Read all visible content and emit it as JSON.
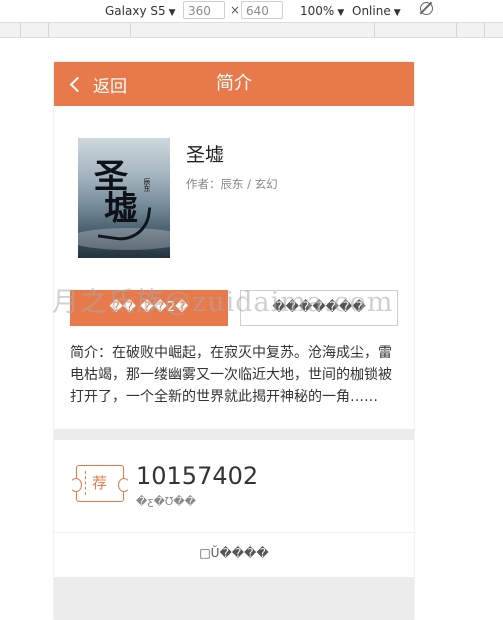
{
  "devtools": {
    "device": "Galaxy S5",
    "width": "360",
    "height": "640",
    "zoom": "100%",
    "network": "Online"
  },
  "header": {
    "back_label": "返回",
    "title": "简介"
  },
  "book": {
    "title": "圣墟",
    "meta": "作者：辰东 / 玄幻",
    "cover_text_1": "圣",
    "cover_text_2": "墟",
    "cover_author": "辰东"
  },
  "actions": {
    "primary_label": "�� ��2�",
    "secondary_label": "�������"
  },
  "summary": "简介：在破败中崛起，在寂灭中复苏。沧海成尘，雷电枯竭，那一缕幽雾又一次临近大地，世间的枷锁被打开了，一个全新的世界就此揭开神秘的一角……",
  "ticket": {
    "icon_char": "荐",
    "count": "10157402",
    "label": "�ƹ�Ʊ��"
  },
  "more_link": "□Ŭ����",
  "watermark": "月之氏族@zuidaima.com",
  "colors": {
    "accent": "#e8794a",
    "band": "#ececec"
  }
}
